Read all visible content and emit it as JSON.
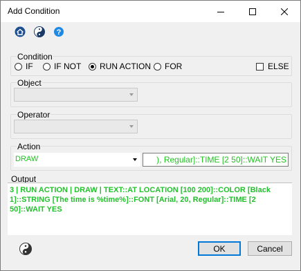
{
  "window": {
    "title": "Add Condition"
  },
  "toolbar": {
    "icons": [
      "home-icon",
      "yin-yang-icon",
      "help-icon"
    ]
  },
  "condition": {
    "legend": "Condition",
    "options": [
      "IF",
      "IF NOT",
      "RUN ACTION",
      "FOR"
    ],
    "selected": "RUN ACTION",
    "else_label": "ELSE",
    "else_checked": false
  },
  "object": {
    "legend": "Object",
    "value": ""
  },
  "operator": {
    "legend": "Operator",
    "value": ""
  },
  "action": {
    "legend": "Action",
    "selected": "DRAW",
    "text": "), Regular]::TIME [2 50]::WAIT YES"
  },
  "output": {
    "label": "Output",
    "text": "3 | RUN ACTION | DRAW | TEXT::AT LOCATION [100 200]::COLOR [Black 1]::STRING [The time is %time%]::FONT [Arial, 20, Regular]::TIME [2 50]::WAIT YES"
  },
  "buttons": {
    "ok": "OK",
    "cancel": "Cancel"
  },
  "colors": {
    "accent": "#0078d7",
    "output_text": "#22c02c"
  }
}
